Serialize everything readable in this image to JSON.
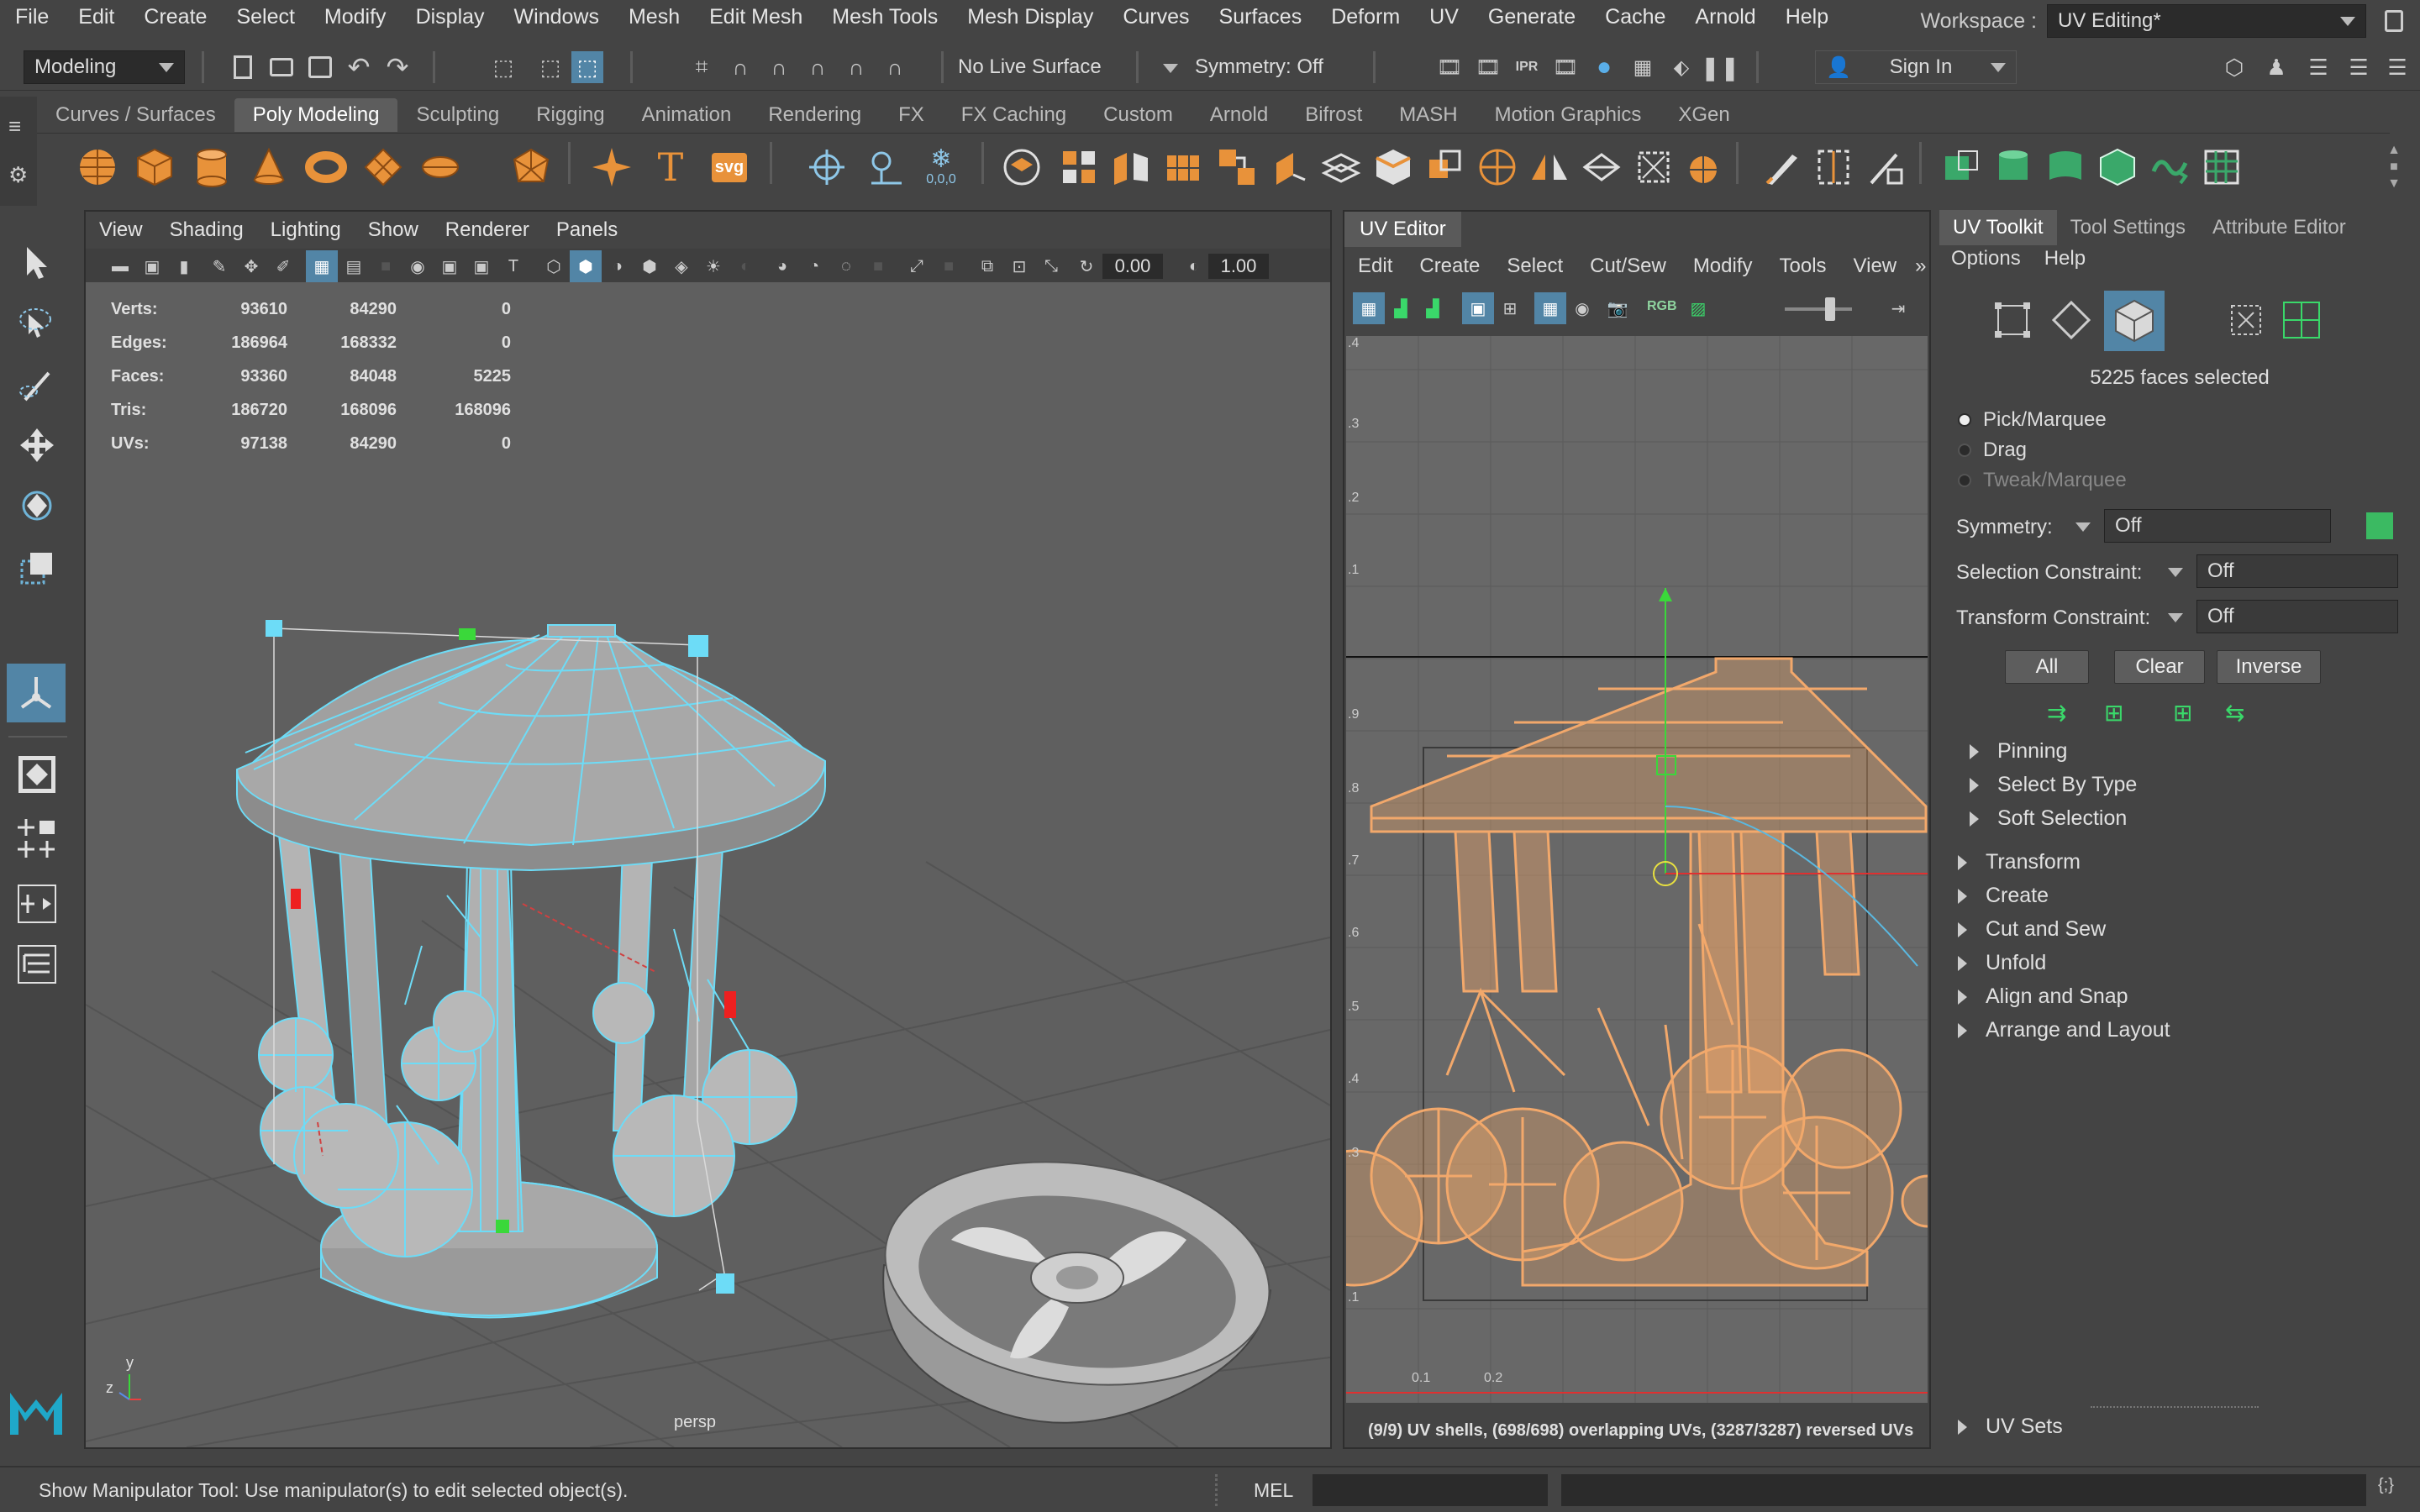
{
  "menubar": {
    "items": [
      "File",
      "Edit",
      "Create",
      "Select",
      "Modify",
      "Display",
      "Windows",
      "Mesh",
      "Edit Mesh",
      "Mesh Tools",
      "Mesh Display",
      "Curves",
      "Surfaces",
      "Deform",
      "UV",
      "Generate",
      "Cache",
      "Arnold",
      "Help"
    ],
    "workspace_label": "Workspace :",
    "workspace_value": "UV Editing*"
  },
  "statusline": {
    "mode": "Modeling",
    "live_surface": "No Live Surface",
    "symmetry": "Symmetry: Off",
    "sign_in": "Sign In"
  },
  "shelf": {
    "tabs": [
      "Curves / Surfaces",
      "Poly Modeling",
      "Sculpting",
      "Rigging",
      "Animation",
      "Rendering",
      "FX",
      "FX Caching",
      "Custom",
      "Arnold",
      "Bifrost",
      "MASH",
      "Motion Graphics",
      "XGen"
    ],
    "active_tab": "Poly Modeling",
    "text_tool": "T",
    "svg_tool": "svg",
    "coord_tool": "0,0,0"
  },
  "viewport": {
    "menu": [
      "View",
      "Shading",
      "Lighting",
      "Show",
      "Renderer",
      "Panels"
    ],
    "exposure": "0.00",
    "gamma": "1.00",
    "camera_label": "persp",
    "hud": [
      {
        "label": "Verts:",
        "a": "93610",
        "b": "84290",
        "c": "0"
      },
      {
        "label": "Edges:",
        "a": "186964",
        "b": "168332",
        "c": "0"
      },
      {
        "label": "Faces:",
        "a": "93360",
        "b": "84048",
        "c": "5225"
      },
      {
        "label": "Tris:",
        "a": "186720",
        "b": "168096",
        "c": "168096"
      },
      {
        "label": "UVs:",
        "a": "97138",
        "b": "84290",
        "c": "0"
      }
    ],
    "axis_y": "y",
    "axis_z": "z"
  },
  "uv_editor": {
    "title": "UV Editor",
    "menu": [
      "Edit",
      "Create",
      "Select",
      "Cut/Sew",
      "Modify",
      "Tools",
      "View"
    ],
    "rgb": "RGB",
    "status": "(9/9) UV shells, (698/698) overlapping UVs, (3287/3287) reversed UVs",
    "v_ticks": [
      ".4",
      ".3",
      ".2",
      ".1",
      ".9",
      ".8",
      ".7",
      ".6",
      ".5",
      ".4",
      ".3",
      ".1"
    ],
    "u_ticks": [
      "0.1",
      "0.2"
    ]
  },
  "uv_toolkit": {
    "tabs": [
      "UV Toolkit",
      "Tool Settings",
      "Attribute Editor"
    ],
    "active_tab": "UV Toolkit",
    "menu": [
      "Options",
      "Help"
    ],
    "selection_count": "5225 faces selected",
    "modes": [
      "Pick/Marquee",
      "Drag",
      "Tweak/Marquee"
    ],
    "symmetry_label": "Symmetry:",
    "symmetry_value": "Off",
    "sel_constraint_label": "Selection Constraint:",
    "sel_constraint_value": "Off",
    "xf_constraint_label": "Transform Constraint:",
    "xf_constraint_value": "Off",
    "buttons": [
      "All",
      "Clear",
      "Inverse"
    ],
    "subsections": [
      "Pinning",
      "Select By Type",
      "Soft Selection"
    ],
    "sections": [
      "Transform",
      "Create",
      "Cut and Sew",
      "Unfold",
      "Align and Snap",
      "Arrange and Layout"
    ],
    "footer_section": "UV Sets"
  },
  "helpline": {
    "message": "Show Manipulator Tool: Use manipulator(s) to edit selected object(s).",
    "mel": "MEL"
  },
  "colors": {
    "accent": "#5285a6",
    "selection": "#6ddcf7",
    "uv": "#f2a86b"
  }
}
